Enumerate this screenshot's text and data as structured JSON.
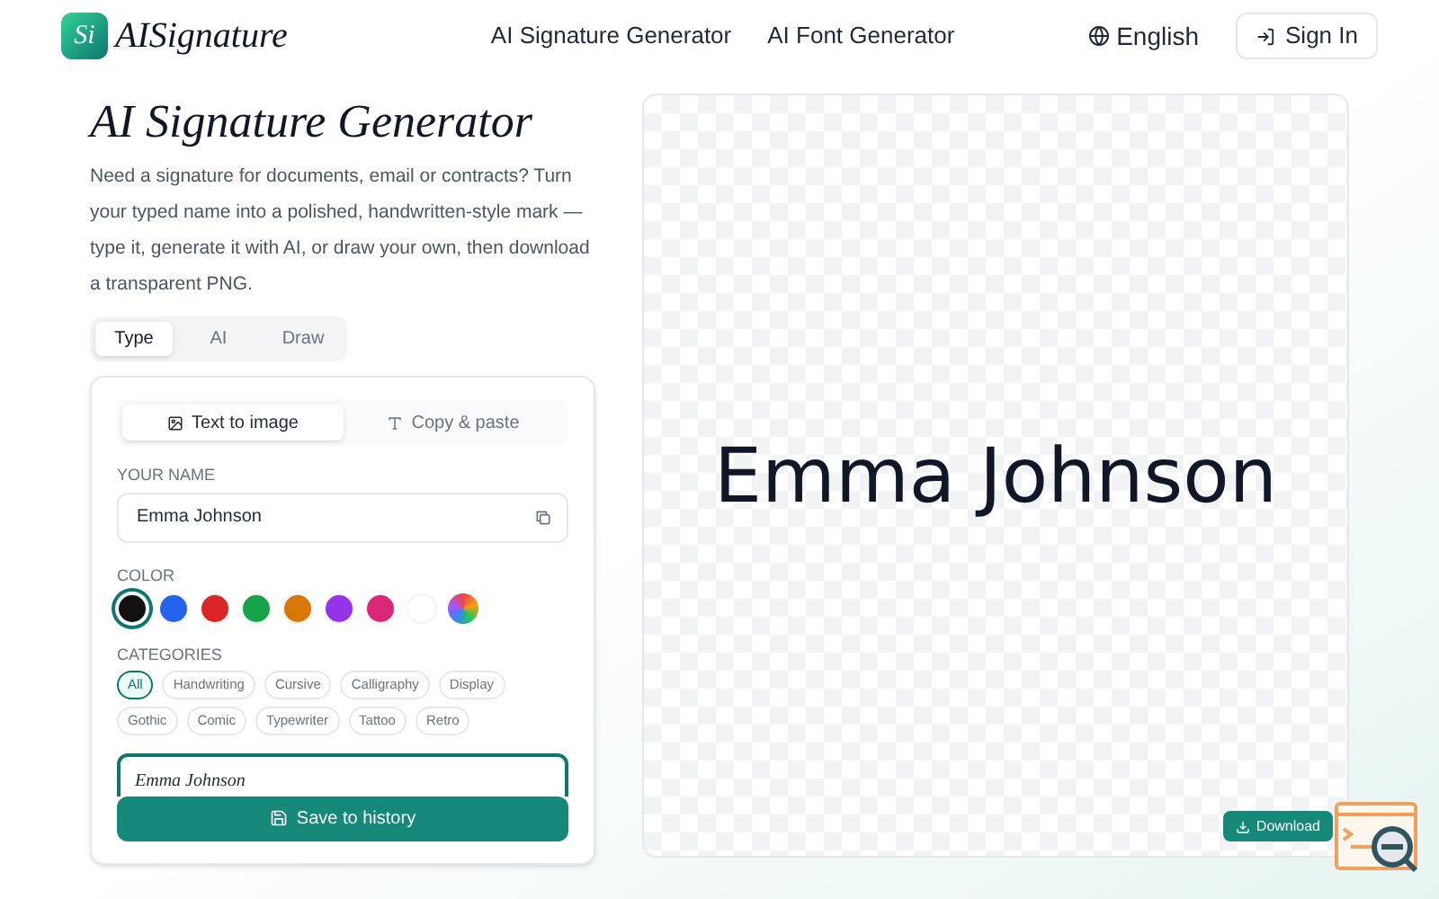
{
  "brand": {
    "logo": "Si",
    "name": "AISignature"
  },
  "nav": [
    {
      "label": "AI Signature Generator"
    },
    {
      "label": "AI Font Generator"
    }
  ],
  "language": "English",
  "sign_in": "Sign In",
  "title": "AI Signature Generator",
  "intro": "Need a signature for documents, email or contracts? Turn your typed name into a polished, handwritten-style mark — type it, generate it with AI, or draw your own, then download a transparent PNG.",
  "mode_tabs": [
    {
      "label": "Type",
      "selected": true
    },
    {
      "label": "AI",
      "selected": false
    },
    {
      "label": "Draw",
      "selected": false
    }
  ],
  "output_tabs": [
    {
      "label": "Text to image",
      "kind": "image",
      "selected": true
    },
    {
      "label": "Copy & paste",
      "kind": "text",
      "selected": false
    }
  ],
  "name_field": {
    "label": "YOUR NAME",
    "value": "Emma Johnson"
  },
  "color_label": "COLOR",
  "colors": [
    {
      "kind": "solid",
      "color": "#111111",
      "selected": true
    },
    {
      "kind": "solid",
      "color": "#2563eb",
      "selected": false
    },
    {
      "kind": "solid",
      "color": "#dc2626",
      "selected": false
    },
    {
      "kind": "solid",
      "color": "#16a34a",
      "selected": false
    },
    {
      "kind": "solid",
      "color": "#d97706",
      "selected": false
    },
    {
      "kind": "solid",
      "color": "#9333ea",
      "selected": false
    },
    {
      "kind": "solid",
      "color": "#db2777",
      "selected": false
    },
    {
      "kind": "solid",
      "color": "#ffffff",
      "selected": false
    },
    {
      "kind": "rainbow",
      "selected": false
    }
  ],
  "categories_label": "CATEGORIES",
  "categories": [
    {
      "label": "All",
      "selected": true
    },
    {
      "label": "Handwriting",
      "selected": false
    },
    {
      "label": "Cursive",
      "selected": false
    },
    {
      "label": "Calligraphy",
      "selected": false
    },
    {
      "label": "Display",
      "selected": false
    },
    {
      "label": "Gothic",
      "selected": false
    },
    {
      "label": "Comic",
      "selected": false
    },
    {
      "label": "Typewriter",
      "selected": false
    },
    {
      "label": "Tattoo",
      "selected": false
    },
    {
      "label": "Retro",
      "selected": false
    }
  ],
  "font_options": [
    {
      "sample": "Emma Johnson",
      "selected": true
    }
  ],
  "save_button": "Save to history",
  "preview": {
    "text": "Emma Johnson"
  },
  "download_button": "Download"
}
